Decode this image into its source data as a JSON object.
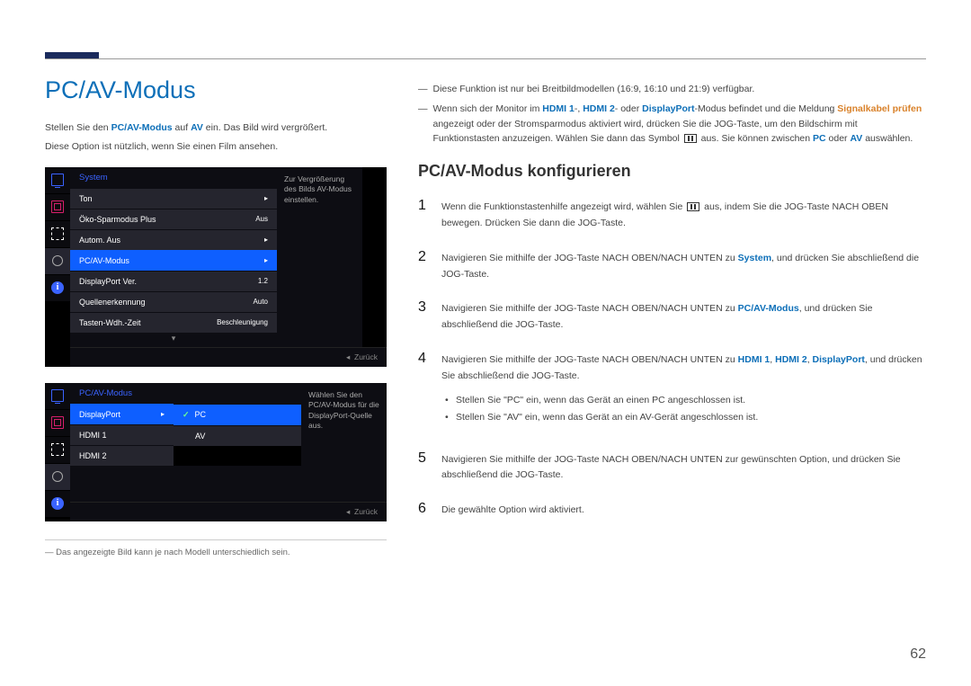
{
  "heading": "PC/AV-Modus",
  "intro1_pre": "Stellen Sie den ",
  "intro1_bold": "PC/AV-Modus",
  "intro1_mid": " auf ",
  "intro1_bold2": "AV",
  "intro1_post": " ein. Das Bild wird vergrößert.",
  "intro2": "Diese Option ist nützlich, wenn Sie einen Film ansehen.",
  "osd1": {
    "category": "System",
    "rows": [
      {
        "label": "Ton",
        "value": "",
        "arrow": true
      },
      {
        "label": "Öko-Sparmodus Plus",
        "value": "Aus"
      },
      {
        "label": "Autom. Aus",
        "value": "",
        "arrow": true
      },
      {
        "label": "PC/AV-Modus",
        "value": "",
        "arrow": true,
        "selected": true
      },
      {
        "label": "DisplayPort Ver.",
        "value": "1.2"
      },
      {
        "label": "Quellenerkennung",
        "value": "Auto"
      },
      {
        "label": "Tasten-Wdh.-Zeit",
        "value": "Beschleunigung"
      }
    ],
    "help": "Zur Vergrößerung des Bilds AV-Modus einstellen.",
    "back": "Zurück"
  },
  "osd2": {
    "category": "PC/AV-Modus",
    "rows": [
      {
        "label": "DisplayPort",
        "selected": true
      },
      {
        "label": "HDMI 1"
      },
      {
        "label": "HDMI 2"
      }
    ],
    "opts": [
      {
        "label": "PC",
        "checked": true,
        "sel": true
      },
      {
        "label": "AV"
      }
    ],
    "help": "Wählen Sie den PC/AV-Modus für die DisplayPort-Quelle aus.",
    "back": "Zurück"
  },
  "footnote": "Das angezeigte Bild kann je nach Modell unterschiedlich sein.",
  "note1": "Diese Funktion ist nur bei Breitbildmodellen (16:9, 16:10 und 21:9) verfügbar.",
  "note2_a": "Wenn sich der Monitor im ",
  "note2_h1": "HDMI 1",
  "note2_b": "-, ",
  "note2_h2": "HDMI 2",
  "note2_c": "- oder ",
  "note2_dp": "DisplayPort",
  "note2_d": "-Modus befindet und die Meldung ",
  "note2_sig": "Signalkabel prüfen",
  "note2_e": " angezeigt oder der Stromsparmodus aktiviert wird, drücken Sie die JOG-Taste, um den Bildschirm mit Funktionstasten anzuzeigen. Wählen Sie dann das Symbol ",
  "note2_f": " aus. Sie können zwischen ",
  "note2_pc": "PC",
  "note2_g": " oder ",
  "note2_av": "AV",
  "note2_h": " auswählen.",
  "subheading": "PC/AV-Modus konfigurieren",
  "steps": {
    "s1a": "Wenn die Funktionstastenhilfe angezeigt wird, wählen Sie ",
    "s1b": " aus, indem Sie die JOG-Taste NACH OBEN bewegen. Drücken Sie dann die JOG-Taste.",
    "s2a": "Navigieren Sie mithilfe der JOG-Taste NACH OBEN/NACH UNTEN zu ",
    "s2sys": "System",
    "s2b": ", und drücken Sie abschließend die JOG-Taste.",
    "s3a": "Navigieren Sie mithilfe der JOG-Taste NACH OBEN/NACH UNTEN zu ",
    "s3pc": "PC/AV-Modus",
    "s3b": ", und drücken Sie abschließend die JOG-Taste.",
    "s4a": "Navigieren Sie mithilfe der JOG-Taste NACH OBEN/NACH UNTEN zu ",
    "s4h1": "HDMI 1",
    "s4c1": ", ",
    "s4h2": "HDMI 2",
    "s4c2": ", ",
    "s4dp": "DisplayPort",
    "s4b": ", und drücken Sie abschließend die JOG-Taste.",
    "b1": "Stellen Sie \"PC\" ein, wenn das Gerät an einen PC angeschlossen ist.",
    "b2": "Stellen Sie \"AV\" ein, wenn das Gerät an ein AV-Gerät angeschlossen ist.",
    "s5": "Navigieren Sie mithilfe der JOG-Taste NACH OBEN/NACH UNTEN zur gewünschten Option, und drücken Sie abschließend die JOG-Taste.",
    "s6": "Die gewählte Option wird aktiviert."
  },
  "pagenum": "62"
}
